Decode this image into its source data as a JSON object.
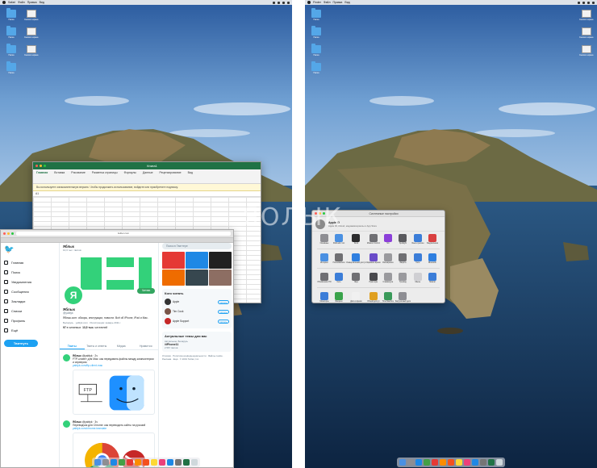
{
  "watermark": "ЯОЛЫК",
  "colors": {
    "excel_green": "#207245",
    "twitter_blue": "#1da1f2",
    "yablyk_green": "#33d17a",
    "follow_green": "#33a560"
  },
  "left_screen": {
    "menubar": {
      "items": [
        "Safari",
        "Файл",
        "Правка",
        "Вид",
        "История",
        "Закладки",
        "Окно",
        "Справка"
      ]
    },
    "desktop_icons": [
      {
        "label": "Папка",
        "icon": "folder-icon"
      },
      {
        "label": "Снимок экрана",
        "icon": "screenshot-icon"
      },
      {
        "label": "Папка",
        "icon": "folder-icon"
      },
      {
        "label": "Снимок экрана",
        "icon": "screenshot-icon"
      },
      {
        "label": "Папка",
        "icon": "folder-icon"
      },
      {
        "label": "Снимок экрана",
        "icon": "screenshot-icon"
      },
      {
        "label": "Папка",
        "icon": "folder-icon"
      }
    ]
  },
  "excel": {
    "title": "Книга1",
    "ribbon_tabs": [
      "Главная",
      "Вставка",
      "Рисование",
      "Разметка страницы",
      "Формулы",
      "Данные",
      "Рецензирование",
      "Вид"
    ],
    "notice": "Вы используете ознакомительную версию. Чтобы продолжить использование, войдите или приобретите подписку.",
    "name_box": "A1"
  },
  "safari": {
    "url": "twitter.com",
    "nav": {
      "items": [
        {
          "label": "Главная",
          "icon": "home-icon"
        },
        {
          "label": "Поиск",
          "icon": "hashtag-icon"
        },
        {
          "label": "Уведомления",
          "icon": "bell-icon"
        },
        {
          "label": "Сообщения",
          "icon": "mail-icon"
        },
        {
          "label": "Закладки",
          "icon": "bookmark-icon"
        },
        {
          "label": "Списки",
          "icon": "list-icon"
        },
        {
          "label": "Профиль",
          "icon": "profile-icon"
        },
        {
          "label": "Ещё",
          "icon": "more-icon"
        }
      ],
      "tweet_button": "Твитнуть"
    },
    "profile": {
      "header_name": "Яблык",
      "header_count": "10,3 тыс. твитов",
      "avatar_letter": "Я",
      "follow_button": "Читаю",
      "name": "Яблык",
      "handle": "@yablyk",
      "bio": "Яблык.com: обзоры, инструкции, новости. Всё об iPhone, iPad и Mac.",
      "meta": "Беларусь · yablyk.com · Регистрация: январь 2011 г.",
      "following_count": "97",
      "following_label": "в читаемых",
      "followers_count": "13,5 тыс.",
      "followers_label": "читателей",
      "tabs": [
        "Твиты",
        "Твиты и ответы",
        "Медиа",
        "Нравится"
      ],
      "active_tab": 0
    },
    "tweets": [
      {
        "author": "Яблык",
        "handle": "@yablyk · 2ч",
        "text": "FTP-клиент для Mac: как передавать файлы между компьютером и сервером",
        "link": "yablyk.com/ftp-client-mac",
        "image_label": "FTP"
      },
      {
        "author": "Яблык",
        "handle": "@yablyk · 3ч",
        "text": "Переводчик для Chrome: как переводить сайты на русский",
        "link": "yablyk.com/chrome-translate",
        "image_label": ""
      }
    ],
    "sidebar": {
      "search_placeholder": "Поиск в Твиттере",
      "who_to_follow_title": "Кого читать",
      "who_to_follow": [
        {
          "name": "Apple",
          "button": "Читать"
        },
        {
          "name": "Tim Cook",
          "button": "Читать"
        },
        {
          "name": "Apple Support",
          "button": "Читать"
        }
      ],
      "trends_title": "Актуальные темы для вас",
      "trends": [
        {
          "category": "Актуальное: Беларусь",
          "title": "#iPhone11",
          "count": "2 567 твитов"
        }
      ],
      "footer": "Условия · Политика конфиденциальности · Файлы cookie · Реклама · Ещё · © 2019 Twitter, Inc."
    }
  },
  "right_screen": {
    "menubar": {
      "items": [
        "Finder",
        "Файл",
        "Правка",
        "Вид",
        "Переход",
        "Окно",
        "Справка"
      ]
    },
    "desktop_icons": [
      {
        "label": "Папка",
        "icon": "folder-icon"
      },
      {
        "label": "Снимок экрана",
        "icon": "screenshot-icon"
      },
      {
        "label": "Папка",
        "icon": "folder-icon"
      },
      {
        "label": "Снимок экрана",
        "icon": "screenshot-icon"
      },
      {
        "label": "Папка",
        "icon": "folder-icon"
      },
      {
        "label": "Снимок экрана",
        "icon": "screenshot-icon"
      },
      {
        "label": "Папка",
        "icon": "folder-icon"
      }
    ]
  },
  "sysprefs": {
    "title": "Системные настройки",
    "user_name": "Apple ID",
    "user_sub": "Apple ID, iCloud, медиаматериалы и App Store",
    "items": [
      {
        "label": "Основные",
        "icon": "general-icon",
        "color": "#8e8e93"
      },
      {
        "label": "Рабочий стол",
        "icon": "desktop-icon",
        "color": "#4a90e2"
      },
      {
        "label": "Dock",
        "icon": "dock-icon",
        "color": "#2c2c2e"
      },
      {
        "label": "Mission Control",
        "icon": "mission-control-icon",
        "color": "#6f6f73"
      },
      {
        "label": "Siri",
        "icon": "siri-icon",
        "color": "#8b3fd9"
      },
      {
        "label": "Spotlight",
        "icon": "spotlight-icon",
        "color": "#5a5a5e"
      },
      {
        "label": "Язык и регион",
        "icon": "globe-icon",
        "color": "#3b7dd8"
      },
      {
        "label": "Уведомления",
        "icon": "notifications-icon",
        "color": "#d94040"
      },
      {
        "label": "Интернет",
        "icon": "at-icon",
        "color": "#4a90e2"
      },
      {
        "label": "Пользователи",
        "icon": "users-icon",
        "color": "#6f6f73"
      },
      {
        "label": "Универсальный доступ",
        "icon": "accessibility-icon",
        "color": "#2f7fe0"
      },
      {
        "label": "Экранное время",
        "icon": "screen-time-icon",
        "color": "#6a4cc9"
      },
      {
        "label": "Расширения",
        "icon": "extensions-icon",
        "color": "#9a9a9e"
      },
      {
        "label": "Защита",
        "icon": "security-icon",
        "color": "#6f6f73"
      },
      {
        "label": "Сеть",
        "icon": "network-icon",
        "color": "#3b7dd8"
      },
      {
        "label": "Bluetooth",
        "icon": "bluetooth-icon",
        "color": "#2f7fe0"
      },
      {
        "label": "Обновление ПО",
        "icon": "software-update-icon",
        "color": "#6f6f73"
      },
      {
        "label": "Сеть",
        "icon": "network-globe-icon",
        "color": "#3b7dd8"
      },
      {
        "label": "Звук",
        "icon": "sound-icon",
        "color": "#6f6f73"
      },
      {
        "label": "Принтеры",
        "icon": "printer-icon",
        "color": "#4a4a4e"
      },
      {
        "label": "Клавиатура",
        "icon": "keyboard-icon",
        "color": "#9a9a9e"
      },
      {
        "label": "Трекпад",
        "icon": "trackpad-icon",
        "color": "#9a9a9e"
      },
      {
        "label": "Мышь",
        "icon": "mouse-icon",
        "color": "#cfcfd3"
      },
      {
        "label": "Sidecar",
        "icon": "sidecar-icon",
        "color": "#3b7dd8"
      },
      {
        "label": "Мониторы",
        "icon": "displays-icon",
        "color": "#3b7dd8"
      },
      {
        "label": "Батарея",
        "icon": "battery-icon",
        "color": "#3aa34b"
      },
      {
        "label": "Дата и время",
        "icon": "clock-icon",
        "color": "#f0f0f0"
      },
      {
        "label": "Общий доступ",
        "icon": "sharing-icon",
        "color": "#e0a020"
      },
      {
        "label": "Time Machine",
        "icon": "time-machine-icon",
        "color": "#3a9a5a"
      },
      {
        "label": "Загрузочный диск",
        "icon": "startup-disk-icon",
        "color": "#8e8e93"
      }
    ]
  }
}
